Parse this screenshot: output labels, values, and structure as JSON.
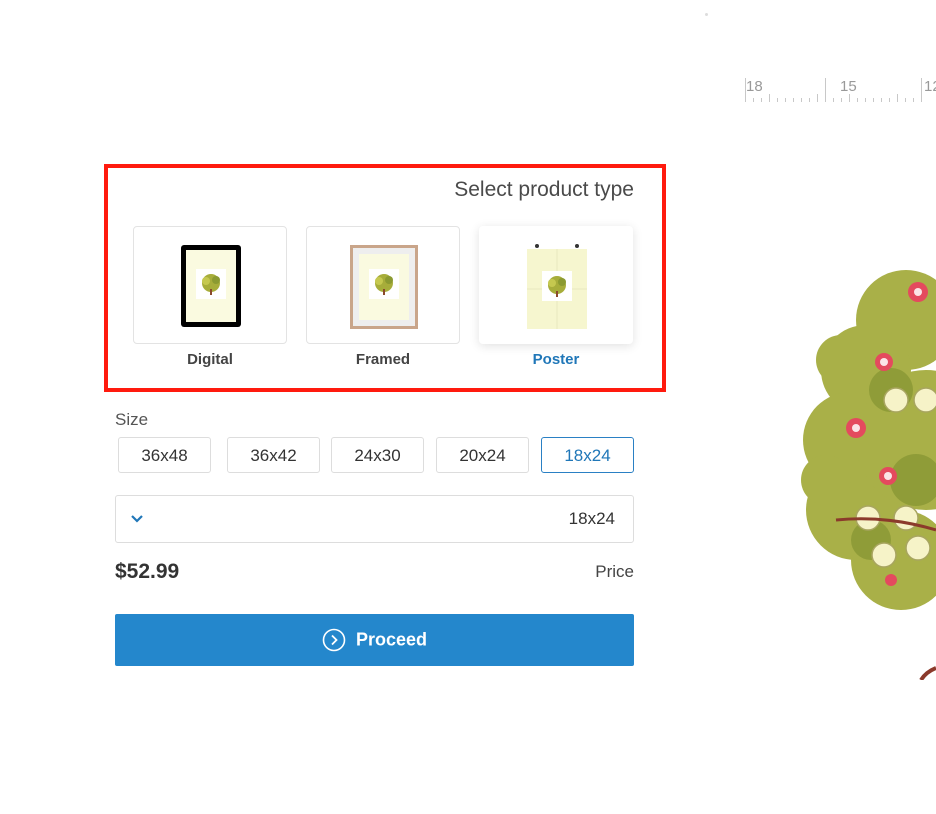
{
  "ruler": {
    "ticks": [
      "18",
      "15",
      "12"
    ]
  },
  "product_type": {
    "title": "Select product type",
    "options": [
      {
        "label": "Digital",
        "selected": false
      },
      {
        "label": "Framed",
        "selected": false
      },
      {
        "label": "Poster",
        "selected": true
      }
    ]
  },
  "size": {
    "label": "Size",
    "options": [
      "36x48",
      "36x42",
      "24x30",
      "20x24",
      "18x24"
    ],
    "selected": "18x24",
    "dropdown_value": "18x24"
  },
  "price": {
    "value": "$52.99",
    "label": "Price"
  },
  "proceed": {
    "label": "Proceed"
  },
  "colors": {
    "accent": "#2487cc",
    "highlight": "#ff1a0e",
    "selected_text": "#2077b8"
  }
}
